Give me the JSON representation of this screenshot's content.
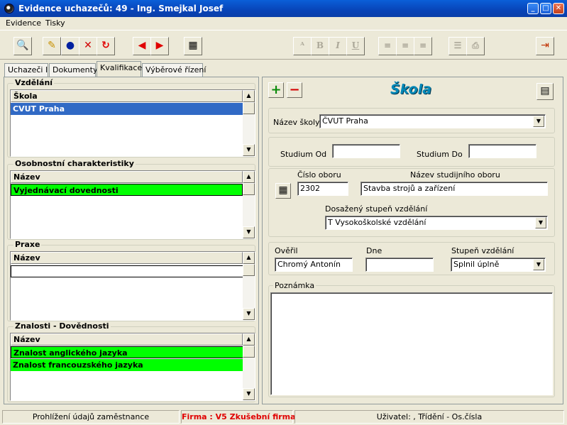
{
  "window": {
    "title": "Evidence uchazečů: 49 - Ing. Smejkal Josef",
    "controls": {
      "minimize": "_",
      "maximize": "□",
      "close": "✕"
    }
  },
  "menu": {
    "items": [
      "Evidence",
      "Tisky"
    ]
  },
  "toolbar": {
    "icons": [
      "search-icon",
      "edit-person-icon",
      "person-icon",
      "delete-person-icon",
      "refresh-icon",
      "arrow-left-icon",
      "arrow-right-icon",
      "calculator-icon",
      "font-icon",
      "bold-icon",
      "italic-icon",
      "underline-icon",
      "align-left-icon",
      "align-center-icon",
      "align-right-icon",
      "bullet-list-icon",
      "print-icon",
      "exit-icon"
    ],
    "format_labels": {
      "bold": "B",
      "italic": "I",
      "underline": "U"
    }
  },
  "tabs": [
    "Uchazeči I",
    "Dokumenty",
    "Kvalifikace",
    "Výběrové řízení"
  ],
  "active_tab": "Kvalifikace",
  "left": {
    "vzdelani": {
      "title": "Vzdělání",
      "header": "Škola",
      "rows": [
        "CVUT Praha"
      ]
    },
    "osobnostni": {
      "title": "Osobnostní charakteristiky",
      "header": "Název",
      "rows": [
        "Vyjednávací dovednosti"
      ]
    },
    "praxe": {
      "title": "Praxe",
      "header": "Název",
      "rows": [
        ""
      ]
    },
    "znalosti": {
      "title": "Znalosti - Dovědnosti",
      "header": "Název",
      "rows": [
        "Znalost anglického jazyka",
        "Znalost francouzského jazyka"
      ]
    }
  },
  "right": {
    "title": "Škola",
    "nazev_skoly_label": "Název školy",
    "nazev_skoly_value": "ČVUT Praha",
    "studium_od_label": "Studium  Od",
    "studium_od_value": "",
    "studium_do_label": "Studium  Do",
    "studium_do_value": "",
    "cislo_oboru_label": "Číslo oboru",
    "cislo_oboru_value": "2302",
    "nazev_oboru_label": "Název studijního oboru",
    "nazev_oboru_value": "Stavba strojů a zařízení",
    "dosazeny_label": "Dosažený stupeň vzdělání",
    "dosazeny_value": "T   Vysokoškolské vzdělání",
    "overil_label": "Ověřil",
    "overil_value": "Chromý Antonín",
    "dne_label": "Dne",
    "dne_value": "",
    "stupen_label": "Stupeň vzdělání",
    "stupen_value": "Splnil úplně",
    "poznamka_label": "Poznámka"
  },
  "status": {
    "left": "Prohlížení údajů zaměstnance",
    "firma": "Firma :  V5 Zkušební firma",
    "right": "Uživatel: , Třídění - Os.čísla"
  }
}
